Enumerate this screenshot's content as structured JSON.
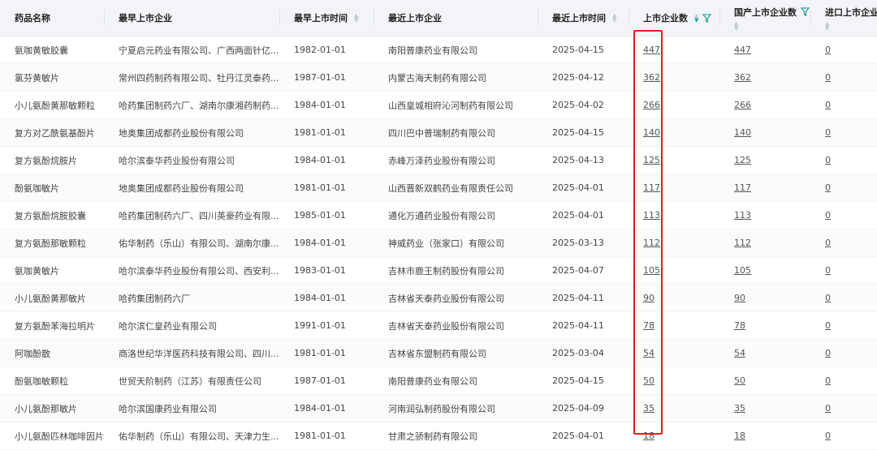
{
  "headers": {
    "drug_name": "药品名称",
    "earliest_company": "最早上市企业",
    "earliest_time": "最早上市时间",
    "latest_company": "最近上市企业",
    "latest_time": "最近上市时间",
    "company_count": "上市企业数",
    "domestic_count": "国产上市企业数",
    "import_count": "进口上市企业数"
  },
  "icons": {
    "sort": "sort-icon",
    "filter": "filter-icon",
    "accent_color": "#1aa39b",
    "highlight_color": "#e0201b"
  },
  "rows": [
    {
      "drug": "氨咖黄敏胶囊",
      "earliest_company": "宁夏启元药业有限公司、广西两面针亿...",
      "earliest_time": "1982-01-01",
      "latest_company": "南阳普康药业有限公司",
      "latest_time": "2025-04-15",
      "count": "447",
      "domestic": "447",
      "import": "0"
    },
    {
      "drug": "氯芬黄敏片",
      "earliest_company": "常州四药制药有限公司、牡丹江灵泰药...",
      "earliest_time": "1987-01-01",
      "latest_company": "内蒙古海天制药有限公司",
      "latest_time": "2025-04-12",
      "count": "362",
      "domestic": "362",
      "import": "0"
    },
    {
      "drug": "小儿氨酚黄那敏颗粒",
      "earliest_company": "哈药集团制药六厂、湖南尔康湘药制药...",
      "earliest_time": "1984-01-01",
      "latest_company": "山西皇城相府沁河制药有限公司",
      "latest_time": "2025-04-02",
      "count": "266",
      "domestic": "266",
      "import": "0"
    },
    {
      "drug": "复方对乙酰氨基酚片",
      "earliest_company": "地奥集团成都药业股份有限公司",
      "earliest_time": "1981-01-01",
      "latest_company": "四川巴中普瑞制药有限公司",
      "latest_time": "2025-04-15",
      "count": "140",
      "domestic": "140",
      "import": "0"
    },
    {
      "drug": "复方氨酚烷胺片",
      "earliest_company": "哈尔滨泰华药业股份有限公司",
      "earliest_time": "1984-01-01",
      "latest_company": "赤峰万泽药业股份有限公司",
      "latest_time": "2025-04-13",
      "count": "125",
      "domestic": "125",
      "import": "0"
    },
    {
      "drug": "酚氨咖敏片",
      "earliest_company": "地奥集团成都药业股份有限公司",
      "earliest_time": "1981-01-01",
      "latest_company": "山西晋新双鹤药业有限责任公司",
      "latest_time": "2025-04-01",
      "count": "117",
      "domestic": "117",
      "import": "0"
    },
    {
      "drug": "复方氨酚烷胺胶囊",
      "earliest_company": "哈药集团制药六厂、四川英豪药业有限...",
      "earliest_time": "1985-01-01",
      "latest_company": "通化万通药业股份有限公司",
      "latest_time": "2025-04-01",
      "count": "113",
      "domestic": "113",
      "import": "0"
    },
    {
      "drug": "复方氨酚那敏颗粒",
      "earliest_company": "佑华制药（乐山）有限公司、湖南尔康...",
      "earliest_time": "1984-01-01",
      "latest_company": "神威药业（张家口）有限公司",
      "latest_time": "2025-03-13",
      "count": "112",
      "domestic": "112",
      "import": "0"
    },
    {
      "drug": "氨咖黄敏片",
      "earliest_company": "哈尔滨泰华药业股份有限公司、西安利...",
      "earliest_time": "1983-01-01",
      "latest_company": "吉林市鹿王制药股份有限公司",
      "latest_time": "2025-04-07",
      "count": "105",
      "domestic": "105",
      "import": "0"
    },
    {
      "drug": "小儿氨酚黄那敏片",
      "earliest_company": "哈药集团制药六厂",
      "earliest_time": "1984-01-01",
      "latest_company": "吉林省天泰药业股份有限公司",
      "latest_time": "2025-04-11",
      "count": "90",
      "domestic": "90",
      "import": "0"
    },
    {
      "drug": "复方氨酚苯海拉明片",
      "earliest_company": "哈尔滨仁皇药业有限公司",
      "earliest_time": "1991-01-01",
      "latest_company": "吉林省天泰药业股份有限公司",
      "latest_time": "2025-04-11",
      "count": "78",
      "domestic": "78",
      "import": "0"
    },
    {
      "drug": "阿咖酚散",
      "earliest_company": "商洛世纪华洋医药科技有限公司、四川...",
      "earliest_time": "1981-01-01",
      "latest_company": "吉林省东盟制药有限公司",
      "latest_time": "2025-03-04",
      "count": "54",
      "domestic": "54",
      "import": "0"
    },
    {
      "drug": "酚氨咖敏颗粒",
      "earliest_company": "世贸天阶制药（江苏）有限责任公司",
      "earliest_time": "1987-01-01",
      "latest_company": "南阳普康药业有限公司",
      "latest_time": "2025-04-15",
      "count": "50",
      "domestic": "50",
      "import": "0"
    },
    {
      "drug": "小儿氨酚那敏片",
      "earliest_company": "哈尔滨国康药业有限公司",
      "earliest_time": "1984-01-01",
      "latest_company": "河南润弘制药股份有限公司",
      "latest_time": "2025-04-09",
      "count": "35",
      "domestic": "35",
      "import": "0"
    },
    {
      "drug": "小儿氨酚匹林咖啡因片",
      "earliest_company": "佑华制药（乐山）有限公司、天津力生...",
      "earliest_time": "1981-01-01",
      "latest_company": "甘肃之骄制药有限公司",
      "latest_time": "2025-04-01",
      "count": "18",
      "domestic": "18",
      "import": "0"
    }
  ]
}
